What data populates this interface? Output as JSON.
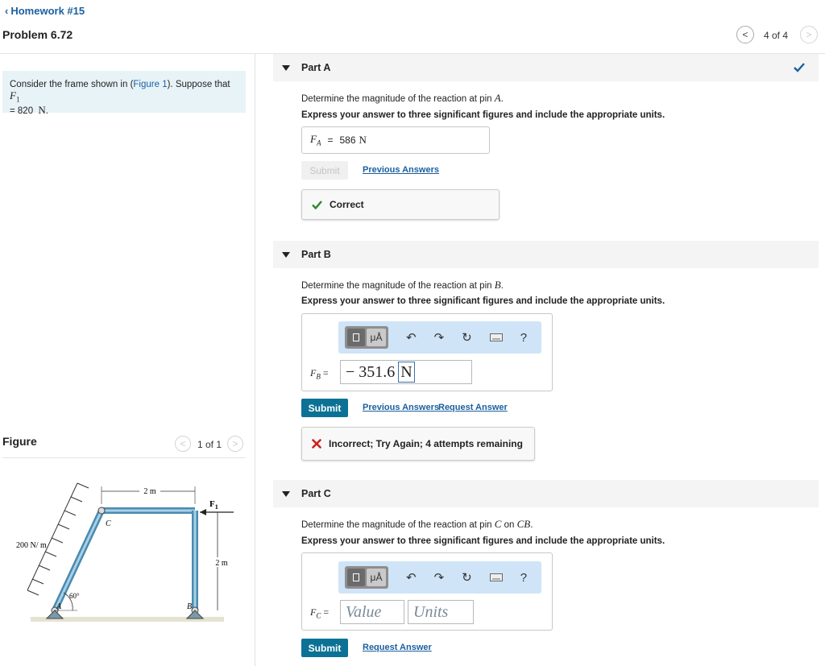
{
  "header": {
    "back_label": "Homework #15",
    "problem_title": "Problem 6.72",
    "nav_prev": "<",
    "nav_count": "4 of 4",
    "nav_next": ">"
  },
  "problem": {
    "text_before": "Consider the frame shown in (",
    "figure_link": "Figure 1",
    "text_after": "). Suppose that ",
    "var_F": "F",
    "var_F_sub": "1",
    "line2": "= 820",
    "unit": "N",
    "period": "."
  },
  "figure_panel": {
    "heading": "Figure",
    "prev": "<",
    "count": "1 of 1",
    "next": ">",
    "labels": {
      "dim_top": "2 m",
      "dim_right": "2 m",
      "load": "200 N/ m",
      "force": "F",
      "force_sub": "1",
      "pin_c": "C",
      "pin_a": "A",
      "pin_b": "B",
      "angle": "60°"
    }
  },
  "part_a": {
    "label": "Part A",
    "question_pre": "Determine the magnitude of the reaction at pin ",
    "question_var": "A",
    "question_post": ".",
    "instruction": "Express your answer to three significant figures and include the appropriate units.",
    "answer_lhs": "F",
    "answer_lhs_sub": "A",
    "eq": "=",
    "answer_value": "586",
    "answer_unit": "N",
    "submit_label": "Submit",
    "previous_answers": "Previous Answers",
    "feedback": "Correct"
  },
  "part_b": {
    "label": "Part B",
    "question_pre": "Determine the magnitude of the reaction at pin ",
    "question_var": "B",
    "question_post": ".",
    "instruction": "Express your answer to three significant figures and include the appropriate units.",
    "answer_lhs": "F",
    "answer_lhs_sub": "B",
    "eq": "=",
    "value": "− 351.6",
    "units": "N",
    "submit_label": "Submit",
    "previous_answers": "Previous Answers",
    "request_answer": "Request Answer",
    "feedback": "Incorrect; Try Again; 4 attempts remaining"
  },
  "part_c": {
    "label": "Part C",
    "question_pre": "Determine the magnitude of the reaction at pin ",
    "question_var": "C",
    "question_mid": " on ",
    "question_var2": "CB",
    "question_post": ".",
    "instruction": "Express your answer to three significant figures and include the appropriate units.",
    "answer_lhs": "F",
    "answer_lhs_sub": "C",
    "eq": "=",
    "value_placeholder": "Value",
    "units_placeholder": "Units",
    "submit_label": "Submit",
    "request_answer": "Request Answer"
  },
  "toolbar": {
    "units_glyph": "μÅ",
    "help": "?"
  },
  "colors": {
    "link": "#1a5f9e",
    "submit": "#0c7295",
    "correct": "#2a8a2a",
    "incorrect": "#cc1f1f",
    "toolbar_bg": "#cfe4f7",
    "problem_bg": "#e8f3f8"
  },
  "icons": {
    "back": "chevron-left-icon",
    "correct": "check-icon",
    "incorrect": "x-icon",
    "undo": "undo-icon",
    "redo": "redo-icon",
    "reset": "reset-icon",
    "keyboard": "keyboard-icon",
    "help": "help-icon"
  }
}
